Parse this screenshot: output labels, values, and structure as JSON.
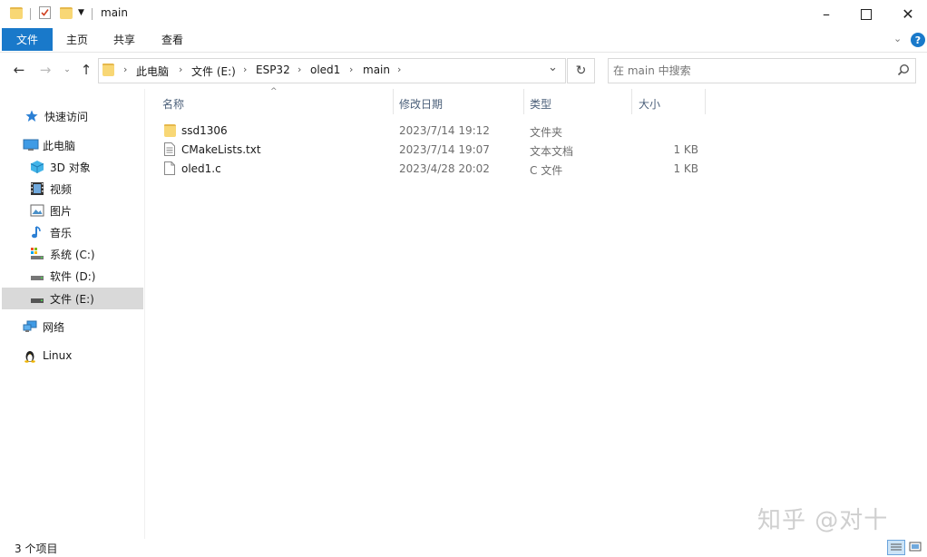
{
  "window": {
    "title": "main",
    "minimize": "–",
    "maximize": "☐",
    "close": "✕"
  },
  "ribbon": {
    "tabs": [
      "文件",
      "主页",
      "共享",
      "查看"
    ],
    "expand_icon": "chevron-down-icon",
    "help_icon": "help-icon"
  },
  "address": {
    "crumbs": [
      "此电脑",
      "文件 (E:)",
      "ESP32",
      "oled1",
      "main"
    ],
    "refresh": "↻"
  },
  "search": {
    "placeholder": "在 main 中搜索"
  },
  "sidebar": {
    "items": [
      {
        "label": "快速访问",
        "icon": "quick-access-star-icon"
      },
      {
        "label": "此电脑",
        "icon": "computer-icon"
      },
      {
        "label": "3D 对象",
        "icon": "3d-objects-icon"
      },
      {
        "label": "视频",
        "icon": "video-icon"
      },
      {
        "label": "图片",
        "icon": "pictures-icon"
      },
      {
        "label": "音乐",
        "icon": "music-icon"
      },
      {
        "label": "系统 (C:)",
        "icon": "drive-c-icon"
      },
      {
        "label": "软件 (D:)",
        "icon": "drive-d-icon"
      },
      {
        "label": "文件 (E:)",
        "icon": "drive-e-icon",
        "selected": true
      },
      {
        "label": "网络",
        "icon": "network-icon"
      },
      {
        "label": "Linux",
        "icon": "linux-icon"
      }
    ]
  },
  "columns": {
    "name": "名称",
    "modified": "修改日期",
    "type": "类型",
    "size": "大小"
  },
  "files": [
    {
      "name": "ssd1306",
      "modified": "2023/7/14 19:12",
      "type": "文件夹",
      "size": "",
      "icon": "folder-icon"
    },
    {
      "name": "CMakeLists.txt",
      "modified": "2023/7/14 19:07",
      "type": "文本文档",
      "size": "1 KB",
      "icon": "text-file-icon"
    },
    {
      "name": "oled1.c",
      "modified": "2023/4/28 20:02",
      "type": "C 文件",
      "size": "1 KB",
      "icon": "c-file-icon"
    }
  ],
  "status": {
    "count": "3 个项目"
  },
  "watermark": "知乎 @对十",
  "colors": {
    "accent": "#1979ca",
    "folder": "#f8d775",
    "selected": "#d9d9d9"
  }
}
